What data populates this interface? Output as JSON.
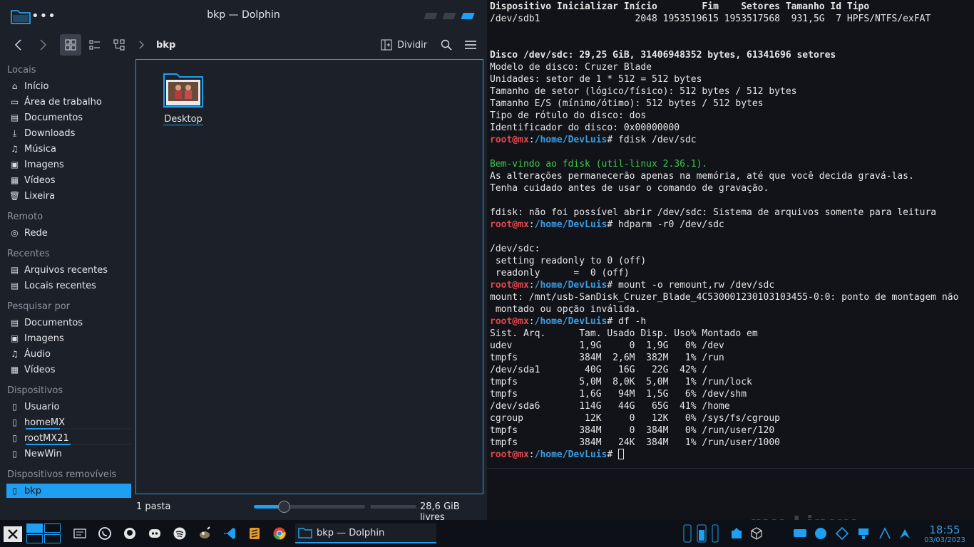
{
  "dolphin": {
    "window_title": "bkp — Dolphin",
    "menu_dots": "•••",
    "toolbar": {
      "breadcrumb": "bkp",
      "split_label": "Dividir"
    },
    "sidebar": {
      "sections": [
        {
          "heading": "Locais",
          "items": [
            {
              "label": "Início",
              "icon": "home-icon"
            },
            {
              "label": "Área de trabalho",
              "icon": "desktop-icon"
            },
            {
              "label": "Documentos",
              "icon": "document-icon"
            },
            {
              "label": "Downloads",
              "icon": "download-icon"
            },
            {
              "label": "Música",
              "icon": "music-icon"
            },
            {
              "label": "Imagens",
              "icon": "image-icon"
            },
            {
              "label": "Vídeos",
              "icon": "video-icon"
            },
            {
              "label": "Lixeira",
              "icon": "trash-icon"
            }
          ]
        },
        {
          "heading": "Remoto",
          "items": [
            {
              "label": "Rede",
              "icon": "network-icon"
            }
          ]
        },
        {
          "heading": "Recentes",
          "items": [
            {
              "label": "Arquivos recentes",
              "icon": "recent-files-icon"
            },
            {
              "label": "Locais recentes",
              "icon": "recent-places-icon"
            }
          ]
        },
        {
          "heading": "Pesquisar por",
          "items": [
            {
              "label": "Documentos",
              "icon": "document-icon"
            },
            {
              "label": "Imagens",
              "icon": "image-icon"
            },
            {
              "label": "Áudio",
              "icon": "music-icon"
            },
            {
              "label": "Vídeos",
              "icon": "video-icon"
            }
          ]
        },
        {
          "heading": "Dispositivos",
          "items": [
            {
              "label": "Usuario",
              "icon": "drive-icon"
            },
            {
              "label": "homeMX",
              "icon": "drive-icon",
              "usage": 0.32
            },
            {
              "label": "rootMX21",
              "icon": "drive-icon",
              "usage": 0.42
            },
            {
              "label": "NewWin",
              "icon": "drive-icon"
            }
          ]
        },
        {
          "heading": "Dispositivos removíveis",
          "items": [
            {
              "label": "bkp",
              "icon": "usb-drive-icon",
              "selected": true
            }
          ]
        }
      ]
    },
    "files": [
      {
        "name": "Desktop",
        "icon": "folder-icon"
      }
    ],
    "status": {
      "count": "1 pasta",
      "free": "28,6 GiB livres",
      "zoom_level": 0.27,
      "used_fraction": 0.02
    }
  },
  "terminal": {
    "lines": [
      "Dispositivo Inicializar Início        Fim    Setores Tamanho Id Tipo",
      "/dev/sdb1                 2048 1953519615 1953517568  931,5G  7 HPFS/NTFS/exFAT",
      "",
      "",
      "Disco /dev/sdc: 29,25 GiB, 31406948352 bytes, 61341696 setores",
      "Modelo de disco: Cruzer Blade",
      "Unidades: setor de 1 * 512 = 512 bytes",
      "Tamanho de setor (lógico/físico): 512 bytes / 512 bytes",
      "Tamanho E/S (mínimo/ótimo): 512 bytes / 512 bytes",
      "Tipo de rótulo do disco: dos",
      "Identificador do disco: 0x00000000",
      "root@mx:/home/DevLuis# fdisk /dev/sdc",
      "",
      "Bem-vindo ao fdisk (util-linux 2.36.1).",
      "As alterações permanecerão apenas na memória, até que você decida gravá-las.",
      "Tenha cuidado antes de usar o comando de gravação.",
      "",
      "fdisk: não foi possível abrir /dev/sdc: Sistema de arquivos somente para leitura",
      "root@mx:/home/DevLuis# hdparm -r0 /dev/sdc",
      "",
      "/dev/sdc:",
      " setting readonly to 0 (off)",
      " readonly      =  0 (off)",
      "root@mx:/home/DevLuis# mount -o remount,rw /dev/sdc",
      "mount: /mnt/usb-SanDisk_Cruzer_Blade_4C530001230103103455-0:0: ponto de montagem não",
      " montado ou opção inválida.",
      "root@mx:/home/DevLuis# df -h",
      "Sist. Arq.      Tam. Usado Disp. Uso% Montado em",
      "udev            1,9G     0  1,9G   0% /dev",
      "tmpfs           384M  2,6M  382M   1% /run",
      "/dev/sda1        40G   16G   22G  42% /",
      "tmpfs           5,0M  8,0K  5,0M   1% /run/lock",
      "tmpfs           1,6G   94M  1,5G   6% /dev/shm",
      "/dev/sda6       114G   44G   65G  41% /home",
      "cgroup           12K     0   12K   0% /sys/fs/cgroup",
      "tmpfs           384M     0  384M   0% /run/user/120",
      "tmpfs           384M   24K  384M   1% /run/user/1000",
      "root@mx:/home/DevLuis# "
    ],
    "bold_lines": [
      0,
      4
    ],
    "green_lines": [
      13
    ]
  },
  "taskbar": {
    "active_task": "bkp — Dolphin",
    "launchers": [
      "file-manager-icon",
      "whatsapp-icon",
      "github-icon",
      "discord-icon",
      "spotify-icon",
      "gimp-icon",
      "vscode-icon",
      "sublime-text-icon",
      "chrome-icon"
    ],
    "watermark": "mx Linux",
    "clock": {
      "time": "18:55",
      "date": "03/03/2023"
    }
  },
  "colors": {
    "accent": "#1e9ff2",
    "prompt_user": "#e0484e",
    "prompt_path": "#3b9be0",
    "success": "#3ac94a"
  }
}
